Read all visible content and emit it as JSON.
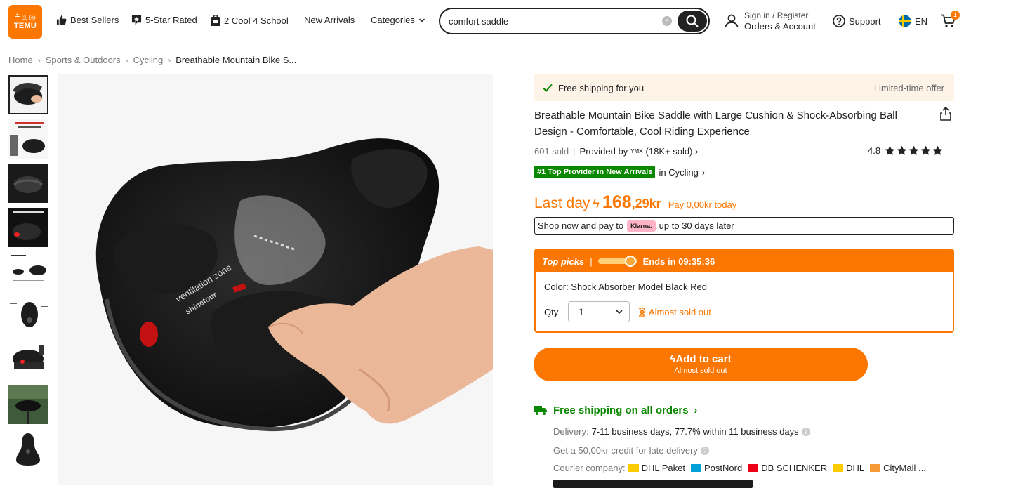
{
  "header": {
    "logo": {
      "glyphs": "≛♨◎",
      "word": "TEMU",
      "color": "#fb7701"
    },
    "nav": [
      {
        "label": "Best Sellers",
        "icon": "thumbs-up-icon"
      },
      {
        "label": "5-Star Rated",
        "icon": "star-badge-icon"
      },
      {
        "label": "2 Cool 4 School",
        "icon": "backpack-icon"
      },
      {
        "label": "New Arrivals",
        "icon": ""
      },
      {
        "label": "Categories",
        "icon": "chevron-down-icon"
      }
    ],
    "search": {
      "value": "comfort saddle"
    },
    "account": {
      "line1": "Sign in / Register",
      "line2": "Orders & Account"
    },
    "support": "Support",
    "language": "EN",
    "cart_count": "1"
  },
  "breadcrumb": [
    "Home",
    "Sports & Outdoors",
    "Cycling",
    "Breathable Mountain Bike S..."
  ],
  "product": {
    "shipping_banner": {
      "text": "Free shipping for you",
      "offer": "Limited-time offer"
    },
    "title": "Breathable Mountain Bike Saddle with Large Cushion & Shock-Absorbing Ball Design - Comfortable, Cool Riding Experience",
    "sold": "601 sold",
    "provided_by": "Provided by",
    "provider_logo": "YMX",
    "provider_sold": "(18K+ sold)",
    "rating": "4.8",
    "stars": 5,
    "rank_badge": "#1 Top Provider in New Arrivals",
    "rank_category": "in Cycling",
    "price": {
      "last_day": "Last day",
      "main": "168",
      "decimal": ",29kr",
      "pay_today": "Pay 0,00kr today"
    },
    "klarna": {
      "before": "Shop now and pay to",
      "logo": "Klarna.",
      "after": "up to 30 days later"
    },
    "top_picks": {
      "label": "Top picks",
      "ends": "Ends in 09:35:36"
    },
    "color": "Color: Shock Absorber Model Black Red",
    "qty_label": "Qty",
    "qty_value": "1",
    "stock": "Almost sold out",
    "add_to_cart": {
      "label": "Add to cart",
      "sub": "Almost sold out"
    },
    "free_shipping": "Free shipping on all orders",
    "delivery": {
      "label": "Delivery:",
      "value": "7-11 business days, 77.7% within 11 business days"
    },
    "credit": "Get a 50,00kr credit for late delivery",
    "courier": {
      "label": "Courier company:",
      "list": [
        "DHL Paket",
        "PostNord",
        "DB SCHENKER",
        "DHL",
        "CityMail ..."
      ]
    }
  },
  "colors": {
    "accent": "#fb7701",
    "green": "#0a8800",
    "banner": "#fdf3e7"
  }
}
